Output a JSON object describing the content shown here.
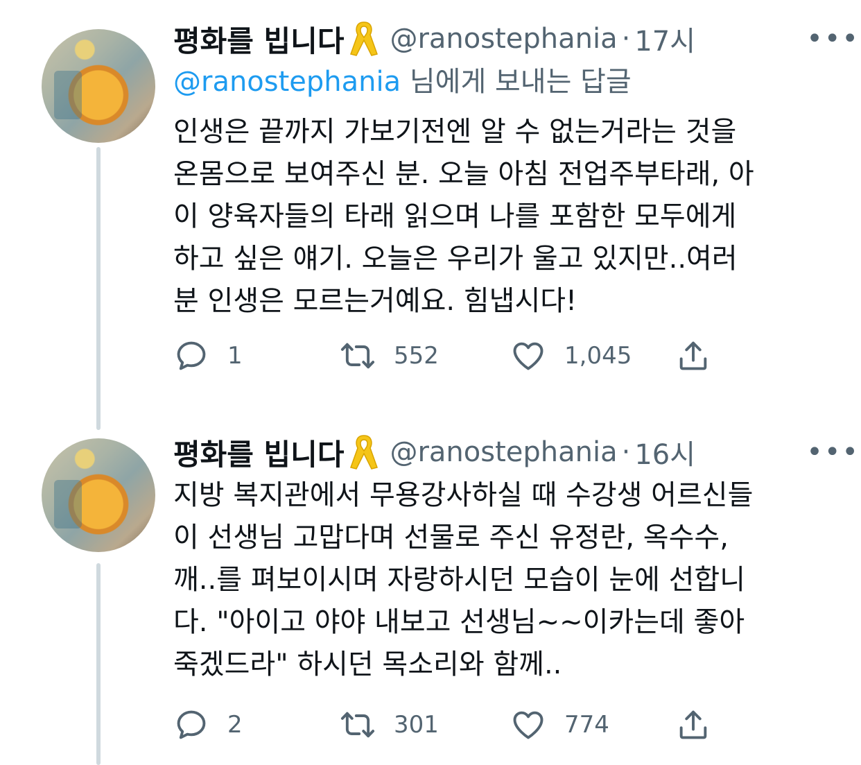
{
  "tweets": [
    {
      "name": "평화를 빕니다",
      "handle": "@ranostephania",
      "dot": "·",
      "time": "17시",
      "reply_to": {
        "mention": "@ranostephania",
        "suffix": " 님에게 보내는 답글"
      },
      "text": "인생은 끝까지 가보기전엔 알 수 없는거라는 것을\n온몸으로 보여주신 분. 오늘 아침 전업주부타래, 아\n이 양육자들의 타래 읽으며 나를 포함한 모두에게\n하고 싶은 얘기. 오늘은 우리가 울고 있지만..여러\n분 인생은 모르는거예요. 힘냅시다!",
      "replies": "1",
      "retweets": "552",
      "likes": "1,045"
    },
    {
      "name": "평화를 빕니다",
      "handle": "@ranostephania",
      "dot": "·",
      "time": "16시",
      "text": "지방 복지관에서 무용강사하실 때 수강생 어르신들\n이 선생님 고맙다며 선물로 주신 유정란, 옥수수,\n깨..를 펴보이시며 자랑하시던 모습이 눈에 선합니\n다. \"아이고 야야 내보고 선생님~~이카는데 좋아\n죽겠드라\" 하시던 목소리와 함께..",
      "replies": "2",
      "retweets": "301",
      "likes": "774"
    }
  ],
  "icons": {
    "more": "more-horizontal-icon",
    "ribbon": "yellow-ribbon-icon",
    "reply": "reply-icon",
    "retweet": "retweet-icon",
    "like": "heart-icon",
    "share": "share-icon"
  },
  "colors": {
    "text": "#0f1419",
    "secondary": "#536471",
    "link": "#1d9bf0",
    "thread_line": "#cfd9de",
    "ribbon": "#f5c518"
  }
}
